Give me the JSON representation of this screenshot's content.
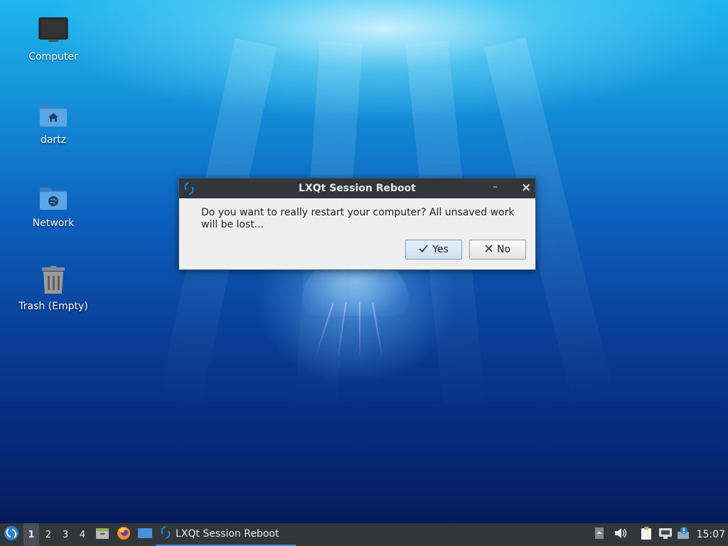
{
  "desktop": {
    "icons": [
      {
        "label": "Computer",
        "icon": "computer-monitor-icon"
      },
      {
        "label": "dartz",
        "icon": "home-folder-icon"
      },
      {
        "label": "Network",
        "icon": "network-folder-icon"
      },
      {
        "label": "Trash (Empty)",
        "icon": "trash-icon"
      }
    ]
  },
  "dialog": {
    "title": "LXQt Session Reboot",
    "app_icon": "lxqt-icon",
    "minimize_label": "–",
    "close_label": "×",
    "message": "Do you want to really restart your computer? All unsaved work will be lost...",
    "yes_label": "Yes",
    "yes_icon": "checkmark-icon",
    "no_label": "No",
    "no_icon": "x-icon"
  },
  "taskbar": {
    "start_icon": "lxqt-start-menu-icon",
    "desktops": [
      "1",
      "2",
      "3",
      "4"
    ],
    "active_desktop": "1",
    "quicklaunch": [
      "file-manager-icon",
      "firefox-icon",
      "show-desktop-icon"
    ],
    "task_label": "LXQt Session Reboot",
    "tray": [
      "tray-arrow-icon",
      "volume-icon",
      "clipboard-icon",
      "network-wired-icon",
      "update-notifier-icon"
    ],
    "clock": "15:07"
  },
  "colors": {
    "panel": "#31363b",
    "accent": "#3d8ee0",
    "dialog_bg": "#efefef"
  }
}
